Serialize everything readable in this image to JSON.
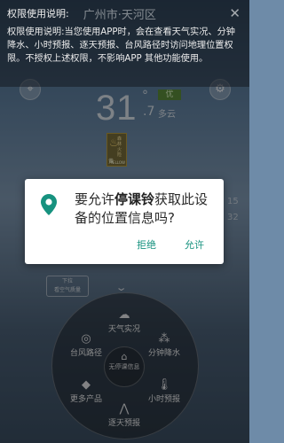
{
  "permission": {
    "title": "权限使用说明:",
    "city": "广州市·天河区",
    "close_icon": "close-icon",
    "text": "权限使用说明:当您使用APP时，会在查看天气实况、分钟降水、小时预报、逐天预报、台风路径时访问地理位置权限。不授权上述权限，不影响APP 其他功能使用。"
  },
  "weather": {
    "temperature": "31",
    "degree": "°",
    "decimal": ".7",
    "condition": "多云",
    "aqi_badge": "优"
  },
  "warning": {
    "text": "森林火险",
    "level": "黄",
    "sub": "YELLOW"
  },
  "dialog": {
    "prefix": "要允许",
    "app_name": "停课铃",
    "suffix": "获取此设备的位置信息吗?",
    "deny_label": "拒绝",
    "allow_label": "允许",
    "accent": "#17927f"
  },
  "side_numbers": {
    "a": "15",
    "b": "32"
  },
  "aq_tag": {
    "line1": "下拉",
    "line2": "看空气质量"
  },
  "menu": {
    "top": {
      "label": "天气实况",
      "icon": "partly-cloudy-icon"
    },
    "left": {
      "label": "台风路径",
      "icon": "typhoon-icon"
    },
    "right": {
      "label": "分钟降水",
      "icon": "raindrops-icon"
    },
    "bottom_left": {
      "label": "更多产品",
      "icon": "tag-icon"
    },
    "bottom_right": {
      "label": "小时预报",
      "icon": "thermometer-icon"
    },
    "bottom": {
      "label": "逐天预报",
      "icon": "trend-icon"
    },
    "center": {
      "label": "无停课信息",
      "icon": "school-icon"
    }
  }
}
